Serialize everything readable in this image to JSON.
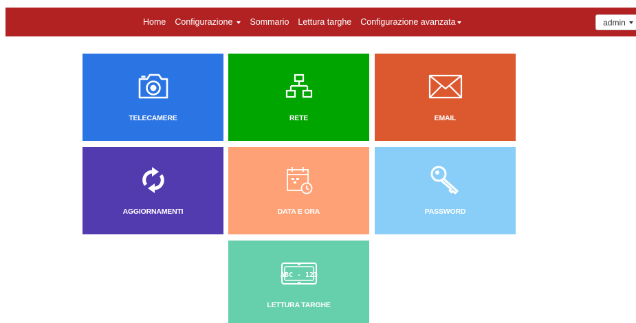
{
  "nav": {
    "items": [
      {
        "label": "Home"
      },
      {
        "label": "Configurazione"
      },
      {
        "label": "Sommario"
      },
      {
        "label": "Lettura targhe"
      },
      {
        "label": "Configurazione avanzata"
      }
    ],
    "user_label": "admin"
  },
  "tiles": [
    {
      "label": "TELECAMERE",
      "icon": "camera-icon",
      "color": "#2b74e3"
    },
    {
      "label": "RETE",
      "icon": "network-icon",
      "color": "#00a500"
    },
    {
      "label": "EMAIL",
      "icon": "envelope-icon",
      "color": "#dc582f"
    },
    {
      "label": "AGGIORNAMENTI",
      "icon": "refresh-icon",
      "color": "#523aaf"
    },
    {
      "label": "DATA E ORA",
      "icon": "calendar-clock-icon",
      "color": "#ffa177"
    },
    {
      "label": "PASSWORD",
      "icon": "key-icon",
      "color": "#89cef8"
    },
    {
      "label": "LETTURA TARGHE",
      "icon": "license-plate-icon",
      "color": "#66cfab"
    }
  ],
  "plate_text": "ABC - 123",
  "colors": {
    "navbar": "#b22222"
  }
}
